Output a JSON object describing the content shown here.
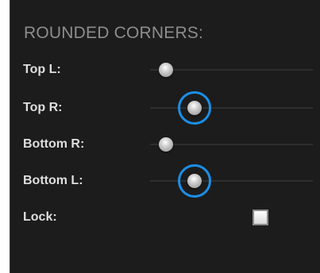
{
  "panel": {
    "title": "ROUNDED CORNERS:"
  },
  "sliders": [
    {
      "label": "Top L:",
      "value": 0.0,
      "focused": false
    },
    {
      "label": "Top R:",
      "value": 0.22,
      "focused": true
    },
    {
      "label": "Bottom R:",
      "value": 0.0,
      "focused": false
    },
    {
      "label": "Bottom L:",
      "value": 0.22,
      "focused": true
    }
  ],
  "lock": {
    "label": "Lock:",
    "checked": false
  },
  "colors": {
    "panel_background": "#1c1c1c",
    "focus_ring": "#1a8fe8",
    "label_text": "#dedede",
    "title_text": "#8d8d8d"
  }
}
